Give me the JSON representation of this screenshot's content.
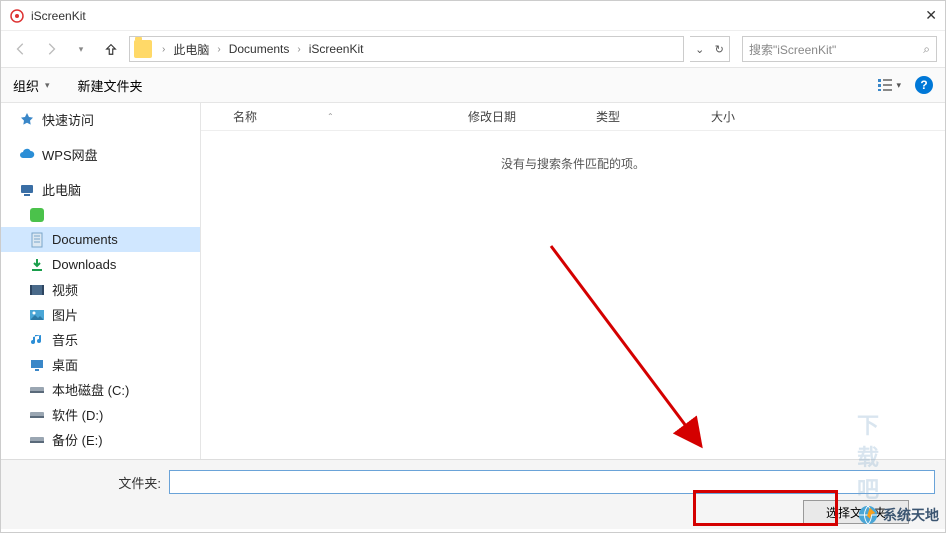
{
  "titlebar": {
    "title": "iScreenKit"
  },
  "breadcrumb": {
    "root": "此电脑",
    "p1": "Documents",
    "p2": "iScreenKit"
  },
  "search": {
    "placeholder": "搜索\"iScreenKit\""
  },
  "toolbar": {
    "organize": "组织",
    "new_folder": "新建文件夹"
  },
  "sidebar": {
    "quick": "快速访问",
    "wps": "WPS网盘",
    "thispc": "此电脑",
    "green_item": "",
    "documents": "Documents",
    "downloads": "Downloads",
    "videos": "视频",
    "pictures": "图片",
    "music": "音乐",
    "desktop": "桌面",
    "cdrive": "本地磁盘 (C:)",
    "ddrive": "软件 (D:)",
    "edrive": "备份 (E:)"
  },
  "columns": {
    "name": "名称",
    "date": "修改日期",
    "type": "类型",
    "size": "大小"
  },
  "content": {
    "empty": "没有与搜索条件匹配的项。"
  },
  "bottom": {
    "folder_label": "文件夹:",
    "select_button": "选择文件夹"
  },
  "watermark": {
    "faded": "下载吧",
    "text": "系统天地"
  }
}
